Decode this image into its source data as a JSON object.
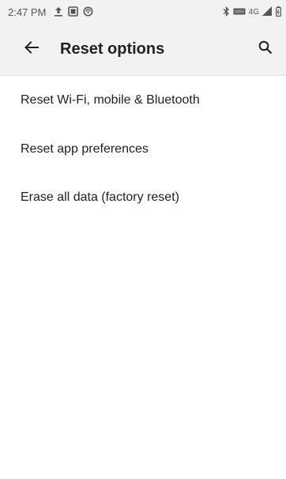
{
  "status_bar": {
    "time": "2:47 PM",
    "left_icons": [
      "upload-icon",
      "gallery-icon",
      "vpn-icon"
    ],
    "right_icons": [
      "bluetooth-icon",
      "volte-icon",
      "signal-4g-icon",
      "signal-icon",
      "battery-icon"
    ],
    "network_label": "4G"
  },
  "app_bar": {
    "title": "Reset options",
    "back_icon": "arrow-left-icon",
    "search_icon": "search-icon"
  },
  "items": [
    {
      "label": "Reset Wi-Fi, mobile & Bluetooth"
    },
    {
      "label": "Reset app preferences"
    },
    {
      "label": "Erase all data (factory reset)"
    }
  ]
}
